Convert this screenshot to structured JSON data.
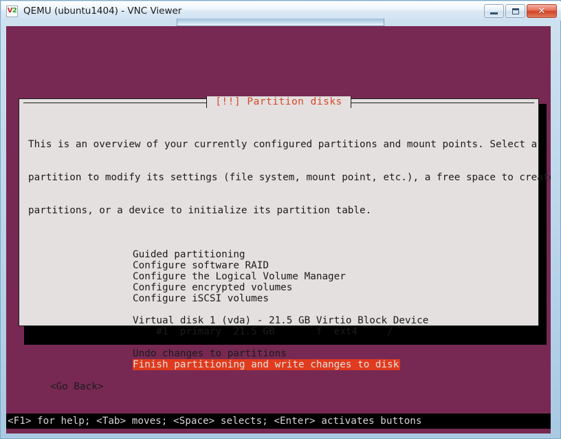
{
  "window": {
    "title": "QEMU (ubuntu1404) - VNC Viewer",
    "icon_name": "vnc-viewer-icon",
    "icon_letter_v": "V",
    "icon_letter_2": "2",
    "buttons": {
      "minimize_label": "Minimize",
      "maximize_label": "Maximize",
      "close_label": "✕"
    }
  },
  "screen": {
    "background_color": "#772953",
    "accent_color": "#e03b1e",
    "dialog_bg_color": "#e4e0df",
    "text_color": "#1b1b1b"
  },
  "dialog": {
    "title": "[!!] Partition disks",
    "description_lines": [
      "This is an overview of your currently configured partitions and mount points. Select a",
      "partition to modify its settings (file system, mount point, etc.), a free space to create",
      "partitions, or a device to initialize its partition table."
    ],
    "menu_items": [
      {
        "label": "Guided partitioning",
        "selected": false
      },
      {
        "label": "Configure software RAID",
        "selected": false
      },
      {
        "label": "Configure the Logical Volume Manager",
        "selected": false
      },
      {
        "label": "Configure encrypted volumes",
        "selected": false
      },
      {
        "label": "Configure iSCSI volumes",
        "selected": false
      }
    ],
    "disk_entries": [
      {
        "label": "Virtual disk 1 (vda) - 21.5 GB Virtio Block Device",
        "selected": false
      },
      {
        "label": "    #1  primary  21.5 GB       f  ext4     /",
        "selected": false
      }
    ],
    "action_items": [
      {
        "label": "Undo changes to partitions",
        "selected": false
      },
      {
        "label": "Finish partitioning and write changes to disk",
        "selected": true
      }
    ],
    "go_back_label": "<Go Back>"
  },
  "status_bar": {
    "text": "<F1> for help; <Tab> moves; <Space> selects; <Enter> activates buttons"
  }
}
